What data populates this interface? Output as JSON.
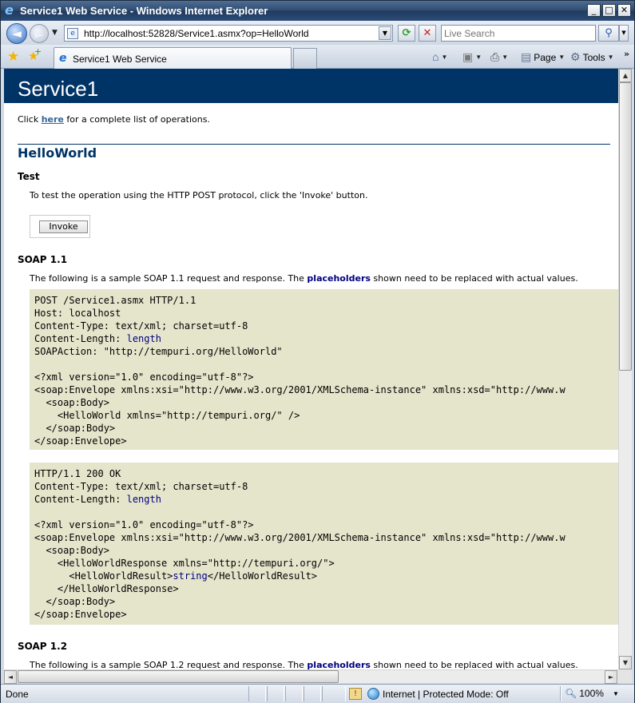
{
  "window": {
    "title": "Service1 Web Service - Windows Internet Explorer",
    "min": "_",
    "max": "□",
    "close": "✕"
  },
  "nav": {
    "url": "http://localhost:52828/Service1.asmx?op=HelloWorld",
    "search_placeholder": "Live Search",
    "back": "◄",
    "forward": "►"
  },
  "tab": {
    "label": "Service1 Web Service"
  },
  "commands": {
    "page": "Page",
    "tools": "Tools"
  },
  "status": {
    "text": "Done",
    "zone": "Internet | Protected Mode: Off",
    "zoom": "100%"
  },
  "page": {
    "heading": "Service1",
    "intro_before": "Click ",
    "intro_link": "here",
    "intro_after": " for a complete list of operations.",
    "operation": "HelloWorld",
    "test_title": "Test",
    "test_text": "To test the operation using the HTTP POST protocol, click the 'Invoke' button.",
    "invoke_label": "Invoke",
    "soap11_title": "SOAP 1.1",
    "soap11_before": "The following is a sample SOAP 1.1 request and response. The ",
    "placeholders": "placeholders",
    "soap_after": " shown need to be replaced with actual values.",
    "soap12_title": "SOAP 1.2",
    "soap12_before": "The following is a sample SOAP 1.2 request and response. The ",
    "request": {
      "line1": "POST /Service1.asmx HTTP/1.1",
      "line2": "Host: localhost",
      "line3": "Content-Type: text/xml; charset=utf-8",
      "line4_label": "Content-Length: ",
      "line4_value": "length",
      "line5": "SOAPAction: \"http://tempuri.org/HelloWorld\"",
      "xml1": "<?xml version=\"1.0\" encoding=\"utf-8\"?>",
      "xml2": "<soap:Envelope xmlns:xsi=\"http://www.w3.org/2001/XMLSchema-instance\" xmlns:xsd=\"http://www.w",
      "xml3": "  <soap:Body>",
      "xml4": "    <HelloWorld xmlns=\"http://tempuri.org/\" />",
      "xml5": "  </soap:Body>",
      "xml6": "</soap:Envelope>"
    },
    "response": {
      "line1": "HTTP/1.1 200 OK",
      "line2": "Content-Type: text/xml; charset=utf-8",
      "line3_label": "Content-Length: ",
      "line3_value": "length",
      "xml1": "<?xml version=\"1.0\" encoding=\"utf-8\"?>",
      "xml2": "<soap:Envelope xmlns:xsi=\"http://www.w3.org/2001/XMLSchema-instance\" xmlns:xsd=\"http://www.w",
      "xml3": "  <soap:Body>",
      "xml4": "    <HelloWorldResponse xmlns=\"http://tempuri.org/\">",
      "xml5_open": "      <HelloWorldResult>",
      "xml5_value": "string",
      "xml5_close": "</HelloWorldResult>",
      "xml6": "    </HelloWorldResponse>",
      "xml7": "  </soap:Body>",
      "xml8": "</soap:Envelope>"
    }
  }
}
